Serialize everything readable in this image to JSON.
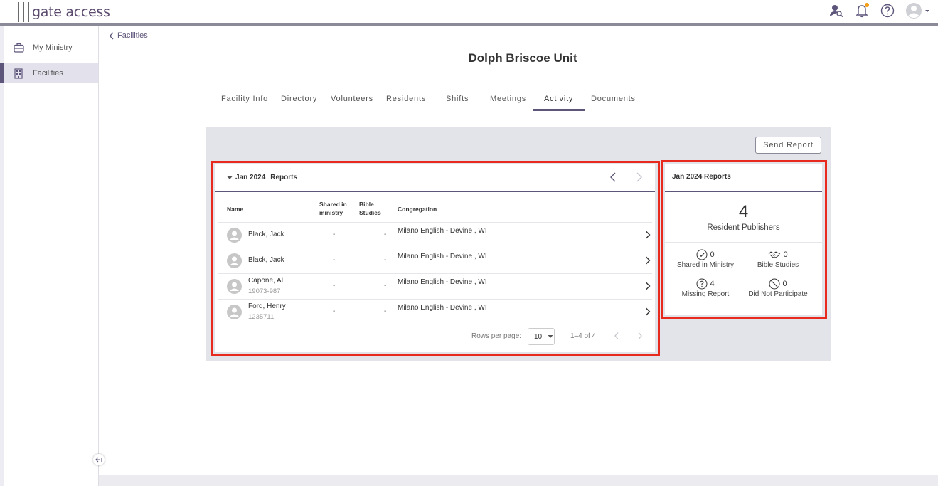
{
  "app": {
    "logo_text": "gate access"
  },
  "sidebar": {
    "items": [
      {
        "label": "My Ministry",
        "icon": "briefcase-icon"
      },
      {
        "label": "Facilities",
        "icon": "building-icon"
      }
    ]
  },
  "breadcrumb": {
    "label": "Facilities"
  },
  "page": {
    "title": "Dolph Briscoe Unit"
  },
  "tabs": [
    "Facility Info",
    "Directory",
    "Volunteers",
    "Residents",
    "Shifts",
    "Meetings",
    "Activity",
    "Documents"
  ],
  "active_tab": "Activity",
  "actions": {
    "send_report": "Send Report"
  },
  "reports_table": {
    "month": "Jan 2024",
    "title_suffix": "Reports",
    "headers": {
      "name": "Name",
      "shared": "Shared in ministry",
      "bible": "Bible Studies",
      "congregation": "Congregation"
    },
    "rows": [
      {
        "name": "Black, Jack",
        "id": "",
        "shared": "-",
        "bible": "-",
        "congregation": "Milano English - Devine , WI"
      },
      {
        "name": "Black, Jack",
        "id": "",
        "shared": "-",
        "bible": "-",
        "congregation": "Milano English - Devine , WI"
      },
      {
        "name": "Capone, Al",
        "id": "19073-987",
        "shared": "-",
        "bible": "-",
        "congregation": "Milano English - Devine , WI"
      },
      {
        "name": "Ford, Henry",
        "id": "1235711",
        "shared": "-",
        "bible": "-",
        "congregation": "Milano English - Devine , WI"
      }
    ],
    "pagination": {
      "rows_per_page_label": "Rows per page:",
      "rows_per_page": "10",
      "range": "1–4 of 4"
    }
  },
  "summary": {
    "title": "Jan 2024 Reports",
    "resident_publishers": "4",
    "resident_publishers_label": "Resident Publishers",
    "stats": {
      "shared": {
        "value": "0",
        "label": "Shared in Ministry"
      },
      "bible": {
        "value": "0",
        "label": "Bible Studies"
      },
      "missing": {
        "value": "4",
        "label": "Missing Report"
      },
      "dnp": {
        "value": "0",
        "label": "Did Not Participate"
      }
    }
  },
  "colors": {
    "accent": "#5e557a",
    "highlight": "#e8291d",
    "notification": "#f39c12",
    "panel_bg": "#e3e3ea"
  }
}
